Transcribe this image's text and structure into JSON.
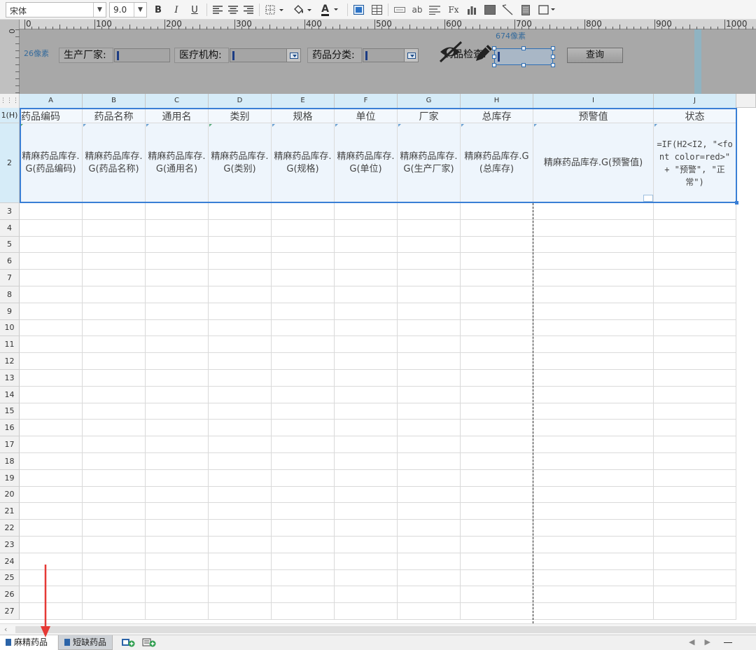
{
  "toolbar": {
    "font_name": "宋体",
    "font_size": "9.0",
    "bold_label": "B",
    "italic_label": "I",
    "underline_label": "U",
    "text_color_label": "A",
    "text_style_label": "ab",
    "function_label": "Fx"
  },
  "ruler": {
    "vertical_zero": "0",
    "marks": [
      "0",
      "100",
      "200",
      "300",
      "400",
      "500",
      "600",
      "700",
      "800",
      "900",
      "1000"
    ],
    "left_px_label": "26像素",
    "top_px_label": "674像素"
  },
  "params": {
    "manufacturer_label": "生产厂家:",
    "institution_label": "医疗机构:",
    "category_label": "药品分类:",
    "drug_check_label": "药品检查:",
    "query_label": "查询"
  },
  "grid": {
    "columns": [
      "A",
      "B",
      "C",
      "D",
      "E",
      "F",
      "G",
      "H",
      "I",
      "J"
    ],
    "row1_label": "1(H)",
    "row2_label": "2",
    "headers": [
      "药品编码",
      "药品名称",
      "通用名",
      "类别",
      "规格",
      "单位",
      "厂家",
      "总库存",
      "预警值",
      "状态"
    ],
    "body_cells": [
      "精麻药品库存.G(药品编码)",
      "精麻药品库存.G(药品名称)",
      "精麻药品库存.G(通用名)",
      "精麻药品库存.G(类别)",
      "精麻药品库存.G(规格)",
      "精麻药品库存.G(单位)",
      "精麻药品库存.G(生产厂家)",
      "精麻药品库存.G(总库存)",
      "精麻药品库存.G(预警值)",
      "=IF(H2<I2, \"<font color=red>\" + \"预警\", \"正常\")"
    ],
    "row_numbers": [
      "3",
      "4",
      "5",
      "6",
      "7",
      "8",
      "9",
      "10",
      "11",
      "12",
      "13",
      "14",
      "15",
      "16",
      "17",
      "18",
      "19",
      "20",
      "21",
      "22",
      "23",
      "24",
      "25",
      "26",
      "27"
    ]
  },
  "sheet_tabs": {
    "active": "麻精药品",
    "other": "短缺药品"
  },
  "colors": {
    "selection": "#3a7fd5",
    "header_area": "#a8a8a8",
    "body_row": "#eef5fc",
    "annotation_arrow": "#e53935"
  }
}
